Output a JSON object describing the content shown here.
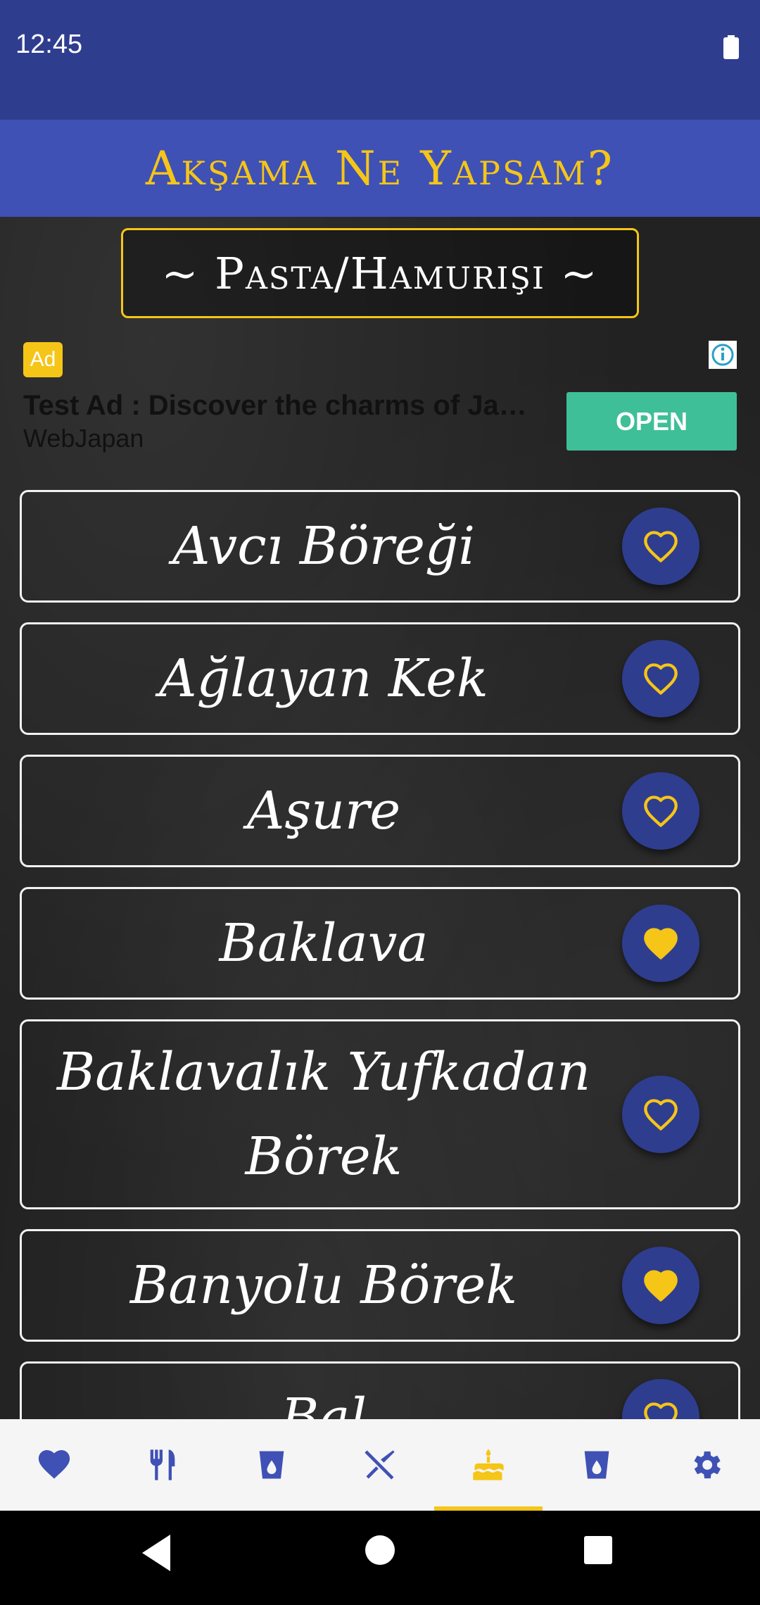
{
  "status": {
    "time": "12:45"
  },
  "app": {
    "title": "Akşama Ne Yapsam?"
  },
  "category": {
    "label": "~ Pasta/Hamurişi ~"
  },
  "ad": {
    "badge": "Ad",
    "title": "Test Ad : Discover the charms of Japan",
    "advertiser": "WebJapan",
    "cta": "OPEN"
  },
  "recipes": [
    {
      "name": "Avcı Böreği",
      "favorite": false
    },
    {
      "name": "Ağlayan Kek",
      "favorite": false
    },
    {
      "name": "Aşure",
      "favorite": false
    },
    {
      "name": "Baklava",
      "favorite": true
    },
    {
      "name": "Baklavalık Yufkadan Börek",
      "favorite": false
    },
    {
      "name": "Banyolu Börek",
      "favorite": true
    },
    {
      "name": "Bal",
      "favorite": false
    }
  ],
  "bottom_nav": {
    "tabs": [
      {
        "icon": "heart-icon",
        "active": false
      },
      {
        "icon": "fork-knife-icon",
        "active": false
      },
      {
        "icon": "soup-bowl-icon",
        "active": false
      },
      {
        "icon": "spoon-fork-cross-icon",
        "active": false
      },
      {
        "icon": "cake-icon",
        "active": true
      },
      {
        "icon": "drink-cup-icon",
        "active": false
      },
      {
        "icon": "settings-gear-icon",
        "active": false
      }
    ]
  },
  "colors": {
    "primary": "#3f51b5",
    "primary_dark": "#2f3d8f",
    "accent": "#f5c518",
    "ad_button": "#3fbf97"
  }
}
